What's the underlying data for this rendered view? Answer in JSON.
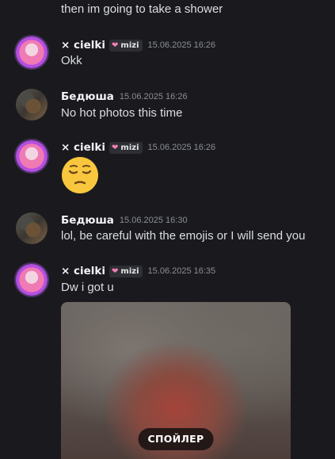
{
  "messages": [
    {
      "content": "then im going to take a shower"
    },
    {
      "author": "× cielki",
      "tag": "mizi",
      "timestamp": "15.06.2025 16:26",
      "content": "Okk"
    },
    {
      "author": "Бедюша",
      "timestamp": "15.06.2025 16:26",
      "content": "No hot photos this time"
    },
    {
      "author": "× cielki",
      "tag": "mizi",
      "timestamp": "15.06.2025 16:26",
      "emoji": "pensive-face-icon"
    },
    {
      "author": "Бедюша",
      "timestamp": "15.06.2025 16:30",
      "content": "lol, be careful with the emojis or I will send you"
    },
    {
      "author": "× cielki",
      "tag": "mizi",
      "timestamp": "15.06.2025 16:35",
      "content": "Dw i got u",
      "attachment": {
        "spoiler_label": "СПОЙЛЕР"
      }
    }
  ],
  "colors": {
    "background": "#1a1a1e",
    "username": "#f2f3f5",
    "message_text": "#dbdee1",
    "timestamp": "#8a8e96",
    "tag_heart": "#f47fb5"
  }
}
